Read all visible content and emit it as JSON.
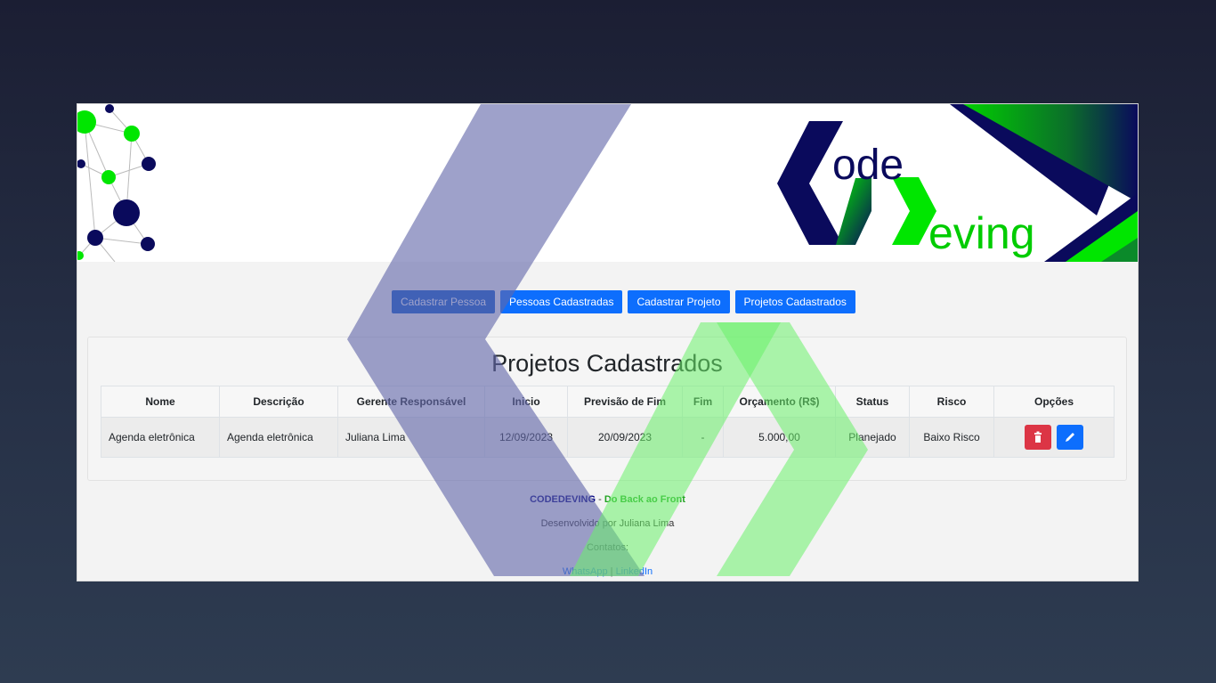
{
  "logo": {
    "line1": "ode",
    "line2": "eving"
  },
  "nav": [
    {
      "label": "Cadastrar Pessoa"
    },
    {
      "label": "Pessoas Cadastradas"
    },
    {
      "label": "Cadastrar Projeto"
    },
    {
      "label": "Projetos Cadastrados"
    }
  ],
  "page": {
    "title": "Projetos Cadastrados"
  },
  "table": {
    "headers": [
      "Nome",
      "Descrição",
      "Gerente Responsável",
      "Inicio",
      "Previsão de Fim",
      "Fim",
      "Orçamento (R$)",
      "Status",
      "Risco",
      "Opções"
    ],
    "rows": [
      {
        "nome": "Agenda eletrônica",
        "descricao": "Agenda eletrônica",
        "gerente": "Juliana Lima",
        "inicio": "12/09/2023",
        "previsao_fim": "20/09/2023",
        "fim": "-",
        "orcamento": "5.000,00",
        "status": "Planejado",
        "risco": "Baixo Risco"
      }
    ]
  },
  "footer": {
    "brand": "CODEDEVING",
    "separator": " - ",
    "tagline": "Do Back ao Front",
    "developed_by": "Desenvolvido por Juliana Lima",
    "contacts_label": "Contatos:",
    "whatsapp": "WhatsApp",
    "link_separator": " | ",
    "linkedin": "LinkedIn"
  },
  "colors": {
    "primary_button": "#0d6efd",
    "danger_button": "#dc3545",
    "brand_navy": "#000080",
    "brand_green": "#00e600"
  },
  "icons": {
    "delete": "trash-icon",
    "edit": "pencil-icon"
  }
}
